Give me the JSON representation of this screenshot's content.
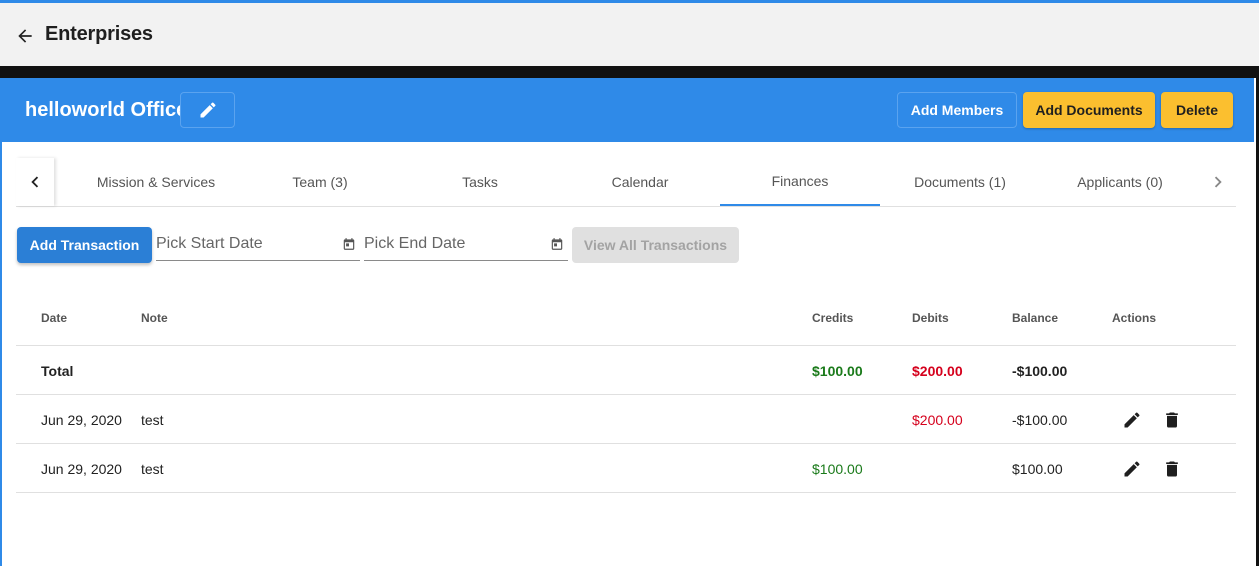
{
  "appbar": {
    "title": "Enterprises"
  },
  "header": {
    "office_name": "helloworld Office",
    "add_members_label": "Add Members",
    "add_documents_label": "Add Documents",
    "delete_label": "Delete"
  },
  "tabs": [
    {
      "label": "Mission & Services"
    },
    {
      "label": "Team (3)"
    },
    {
      "label": "Tasks"
    },
    {
      "label": "Calendar"
    },
    {
      "label": "Finances"
    },
    {
      "label": "Documents (1)"
    },
    {
      "label": "Applicants (0)"
    }
  ],
  "active_tab": "Finances",
  "toolbar": {
    "add_transaction_label": "Add Transaction",
    "start_date_placeholder": "Pick Start Date",
    "end_date_placeholder": "Pick End Date",
    "view_all_label": "View All Transactions"
  },
  "table": {
    "columns": {
      "date": "Date",
      "note": "Note",
      "credits": "Credits",
      "debits": "Debits",
      "balance": "Balance",
      "actions": "Actions"
    },
    "total": {
      "label": "Total",
      "credits": "$100.00",
      "debits": "$200.00",
      "balance": "-$100.00"
    },
    "rows": [
      {
        "date": "Jun 29, 2020",
        "note": "test",
        "credits": "",
        "debits": "$200.00",
        "balance": "-$100.00"
      },
      {
        "date": "Jun 29, 2020",
        "note": "test",
        "credits": "$100.00",
        "debits": "",
        "balance": "$100.00"
      }
    ]
  },
  "colors": {
    "primary": "#2f8ae8",
    "accent": "#fbbf2f",
    "credit": "#1a7a1a",
    "debit": "#d5001c"
  },
  "icons": [
    "arrow-left-icon",
    "pencil-icon",
    "chevron-left-icon",
    "chevron-right-icon",
    "calendar-icon",
    "trash-icon"
  ]
}
